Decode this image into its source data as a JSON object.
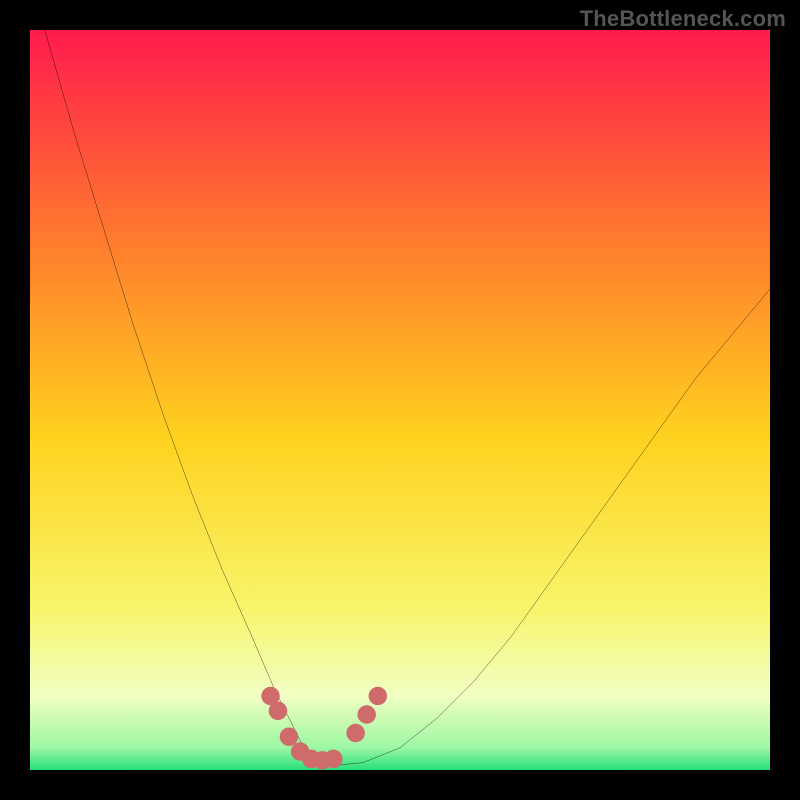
{
  "watermark": "TheBottleneck.com",
  "colors": {
    "black": "#000000",
    "curve": "#000000",
    "dot": "#cf6b6b",
    "grad_top": "#ff1a4d",
    "grad_mid1": "#ff7a2e",
    "grad_mid2": "#ffd21e",
    "grad_mid3": "#f8f56a",
    "grad_mid4": "#f1ffc2",
    "grad_bot": "#26e07a"
  },
  "chart_data": {
    "type": "line",
    "title": "",
    "xlabel": "",
    "ylabel": "",
    "xlim": [
      0,
      100
    ],
    "ylim": [
      0,
      100
    ],
    "series": [
      {
        "name": "bottleneck-curve",
        "x": [
          2,
          6,
          10,
          14,
          18,
          22,
          26,
          30,
          33,
          35,
          37,
          38.5,
          40,
          45,
          50,
          55,
          60,
          65,
          70,
          75,
          80,
          85,
          90,
          95,
          100
        ],
        "y": [
          100,
          86,
          73,
          60,
          48,
          37,
          27,
          18,
          11,
          7,
          3,
          1,
          0.5,
          1,
          3,
          7,
          12,
          18,
          25,
          32,
          39,
          46,
          53,
          59,
          65
        ]
      }
    ],
    "markers": {
      "name": "highlight-dots",
      "x": [
        32.5,
        33.5,
        35,
        36.5,
        38,
        39.5,
        41,
        44,
        45.5,
        47
      ],
      "y": [
        10,
        8,
        4.5,
        2.5,
        1.5,
        1.3,
        1.5,
        5,
        7.5,
        10
      ]
    }
  }
}
